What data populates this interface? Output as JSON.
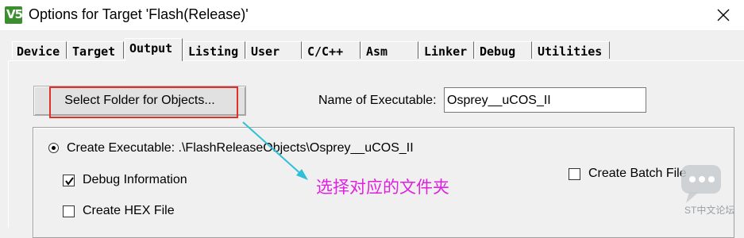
{
  "window": {
    "title": "Options for Target 'Flash(Release)'",
    "app_icon_glyph": "V5",
    "close_glyph": "close-icon"
  },
  "tabs": [
    {
      "label": "Device"
    },
    {
      "label": "Target"
    },
    {
      "label": "Output",
      "active": true
    },
    {
      "label": "Listing"
    },
    {
      "label": "User"
    },
    {
      "label": "C/C++"
    },
    {
      "label": "Asm"
    },
    {
      "label": "Linker"
    },
    {
      "label": "Debug"
    },
    {
      "label": "Utilities"
    }
  ],
  "output": {
    "select_folder_button": "Select Folder for Objects...",
    "name_label": "Name of Executable:",
    "name_value": "Osprey__uCOS_II",
    "create_executable_label": "Create Executable:  .\\FlashReleaseObjects\\Osprey__uCOS_II",
    "debug_info_label": "Debug Information",
    "create_hex_label": "Create HEX File",
    "create_batch_label": "Create Batch File",
    "debug_info_checked": true,
    "create_hex_checked": false,
    "create_batch_checked": false
  },
  "annotation": {
    "text": "选择对应的文件夹",
    "color": "#e020e0",
    "highlight_color": "#e0302a",
    "arrow_color": "#2fc0d8"
  },
  "watermark": {
    "text": "ST中文论坛"
  }
}
